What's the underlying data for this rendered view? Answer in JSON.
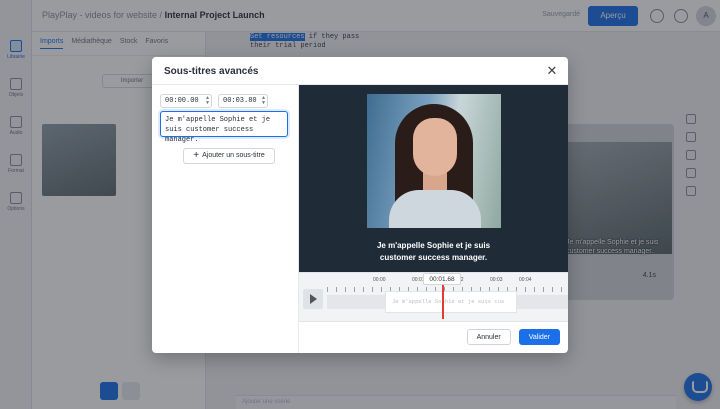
{
  "topbar": {
    "project_prefix": "PlayPlay - videos for website / ",
    "project_name": "Internal Project Launch",
    "status": "Sauvegardé",
    "share_label": "Aperçu",
    "avatar_initial": "A"
  },
  "leftrail": {
    "items": [
      {
        "label": "Librairie",
        "icon": "library-icon"
      },
      {
        "label": "Objets",
        "icon": "objects-icon"
      },
      {
        "label": "Audio",
        "icon": "audio-icon"
      },
      {
        "label": "Format",
        "icon": "format-icon"
      },
      {
        "label": "Options",
        "icon": "gear-icon"
      }
    ]
  },
  "panel": {
    "tabs": [
      "Imports",
      "Médiathèque",
      "Stock",
      "Favoris"
    ],
    "import_label": "Importer"
  },
  "workspace": {
    "code_highlight": "Get resources",
    "code_line1_rest": " if they pass",
    "code_line2": "their trial period",
    "scene_caption": "Je m'appelle Sophie et je suis customer success manager.",
    "scene_duration": "4.1s",
    "bottom_placeholder": "Ajouter une scène"
  },
  "modal": {
    "title": "Sous-titres avancés",
    "timecode_start": "00:00.00",
    "timecode_end": "00:03.80",
    "subtitle_text": "Je m'appelle Sophie et je suis customer success manager.",
    "add_subtitle_label": "Ajouter un sous-titre",
    "caption_line1": "Je m'appelle Sophie et je suis",
    "caption_line2": "customer success manager.",
    "timeline": {
      "ticks": [
        "00:00",
        "00:01",
        "00:02",
        "00:03",
        "00:04"
      ],
      "playhead_time": "00:01.68",
      "clip_text": "Je m'appelle Sophie et je suis cus"
    },
    "cancel_label": "Annuler",
    "confirm_label": "Valider"
  },
  "colors": {
    "accent": "#1b6fe8",
    "playhead": "#e53935",
    "preview_bg": "#1f2b37"
  }
}
